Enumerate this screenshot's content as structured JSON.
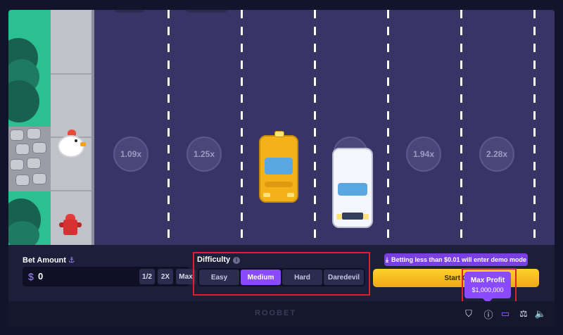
{
  "game": {
    "multipliers": [
      "1.09x",
      "1.25x",
      "1.94x",
      "2.28x"
    ]
  },
  "bet": {
    "label": "Bet Amount",
    "currency_symbol": "$",
    "value": "0",
    "buttons": [
      "1/2",
      "2X",
      "Max"
    ]
  },
  "difficulty": {
    "label": "Difficulty",
    "info_icon": "info-icon",
    "options": [
      "Easy",
      "Medium",
      "Hard",
      "Daredevil"
    ],
    "selected": "Medium"
  },
  "demo_notice": "Betting less than $0.01 will enter demo mode",
  "start_label": "Start G",
  "max_profit": {
    "title": "Max Profit",
    "value": "$1,000,000"
  },
  "footer": {
    "logo": "ROOBET",
    "icons": [
      "shield-icon",
      "info-icon",
      "display-icon",
      "balance-icon",
      "volume-icon"
    ]
  },
  "colors": {
    "accent": "#8a4bff",
    "start": "#ffd12a",
    "highlight": "#e0202e",
    "road": "#383566"
  }
}
